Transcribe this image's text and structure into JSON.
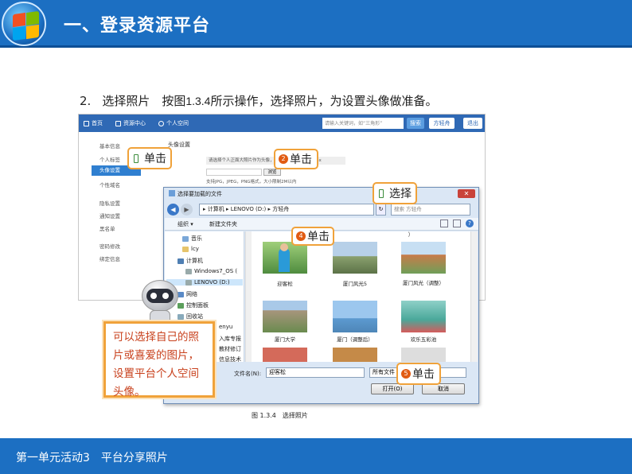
{
  "header": {
    "title": "一、登录资源平台"
  },
  "footer": {
    "text": "第一单元活动3　平台分享照片"
  },
  "step": {
    "number": "2.",
    "text_a": "选择照片　按图",
    "ref": "1.3.4",
    "text_b": "所示操作，选择照片，为设置头像做准备。"
  },
  "web": {
    "nav": [
      "首页",
      "资源中心",
      "个人空间"
    ],
    "search_placeholder": "请输入关键词，如“三角形”",
    "search_btn": "搜索",
    "user": "方轻舟",
    "logout": "退出",
    "sidebar": [
      "基本信息",
      "个人标签",
      "头像设置",
      "个性域名",
      "隐私设置",
      "通知设置",
      "黑名单",
      "密码修改",
      "绑定信息"
    ],
    "content_title": "头像设置",
    "upload_tip": "请选择个人正面大照片作为头像，最大尺寸200px*300px",
    "browse": "浏览",
    "format_hint": "支持JPG，JPEG，PNG格式，大小限制2M以内"
  },
  "dialog": {
    "title": "选择要加载的文件",
    "address": "▸ 计算机 ▸ LENOVO (D:) ▸ 方轻舟",
    "search_placeholder": "搜索 方轻舟",
    "organize": "组织 ▾",
    "new_folder": "新建文件夹",
    "tree": [
      "音乐",
      "lcy",
      "计算机",
      "Windows7_OS (",
      "LENOVO (D:)",
      "网络",
      "控制面板",
      "回收站",
      "enyu",
      "入库专报",
      "教材修订",
      "信息技术"
    ],
    "files": [
      "迎客松",
      "厦门风光5",
      "厦门风光（调整）",
      "厦门大学",
      "厦门（调整后）",
      "欢乐五彩池"
    ],
    "top_partial": "）",
    "filename_label": "文件名(N):",
    "filename": "迎客松",
    "filetype": "所有文件 (*.*)",
    "open": "打开(O)",
    "cancel": "取消"
  },
  "callouts": {
    "c1": "单击",
    "c2_num": "2",
    "c2": "单击",
    "c3": "选择",
    "c4_num": "4",
    "c4": "单击",
    "c5_num": "5",
    "c5": "单击"
  },
  "tip": {
    "text": "可以选择自己的照片或喜爱的图片，设置平台个人空间头像。"
  },
  "caption": {
    "text": "图 1.3.4　选择照片"
  }
}
